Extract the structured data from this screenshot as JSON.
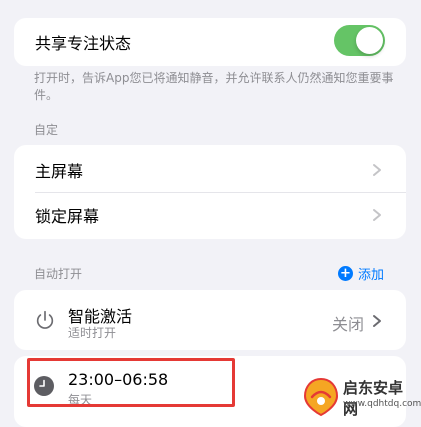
{
  "share_focus": {
    "label": "共享专注状态",
    "toggle_on": true,
    "note": "打开时，告诉App您已将通知静音，并允许联系人仍然通知您重要事件。"
  },
  "customize": {
    "header": "自定",
    "items": [
      {
        "label": "主屏幕"
      },
      {
        "label": "锁定屏幕"
      }
    ]
  },
  "auto_on": {
    "header": "自动打开",
    "add_label": "添加",
    "smart": {
      "title": "智能激活",
      "subtitle": "适时打开",
      "value": "关闭"
    },
    "schedule": {
      "time": "23:00–06:58",
      "days": "每天"
    }
  },
  "watermark": {
    "title": "启东安卓网",
    "url": "www.qdhtdq.com"
  },
  "colors": {
    "accent": "#007aff",
    "toggle_on": "#65c466",
    "highlight": "#e53935"
  }
}
